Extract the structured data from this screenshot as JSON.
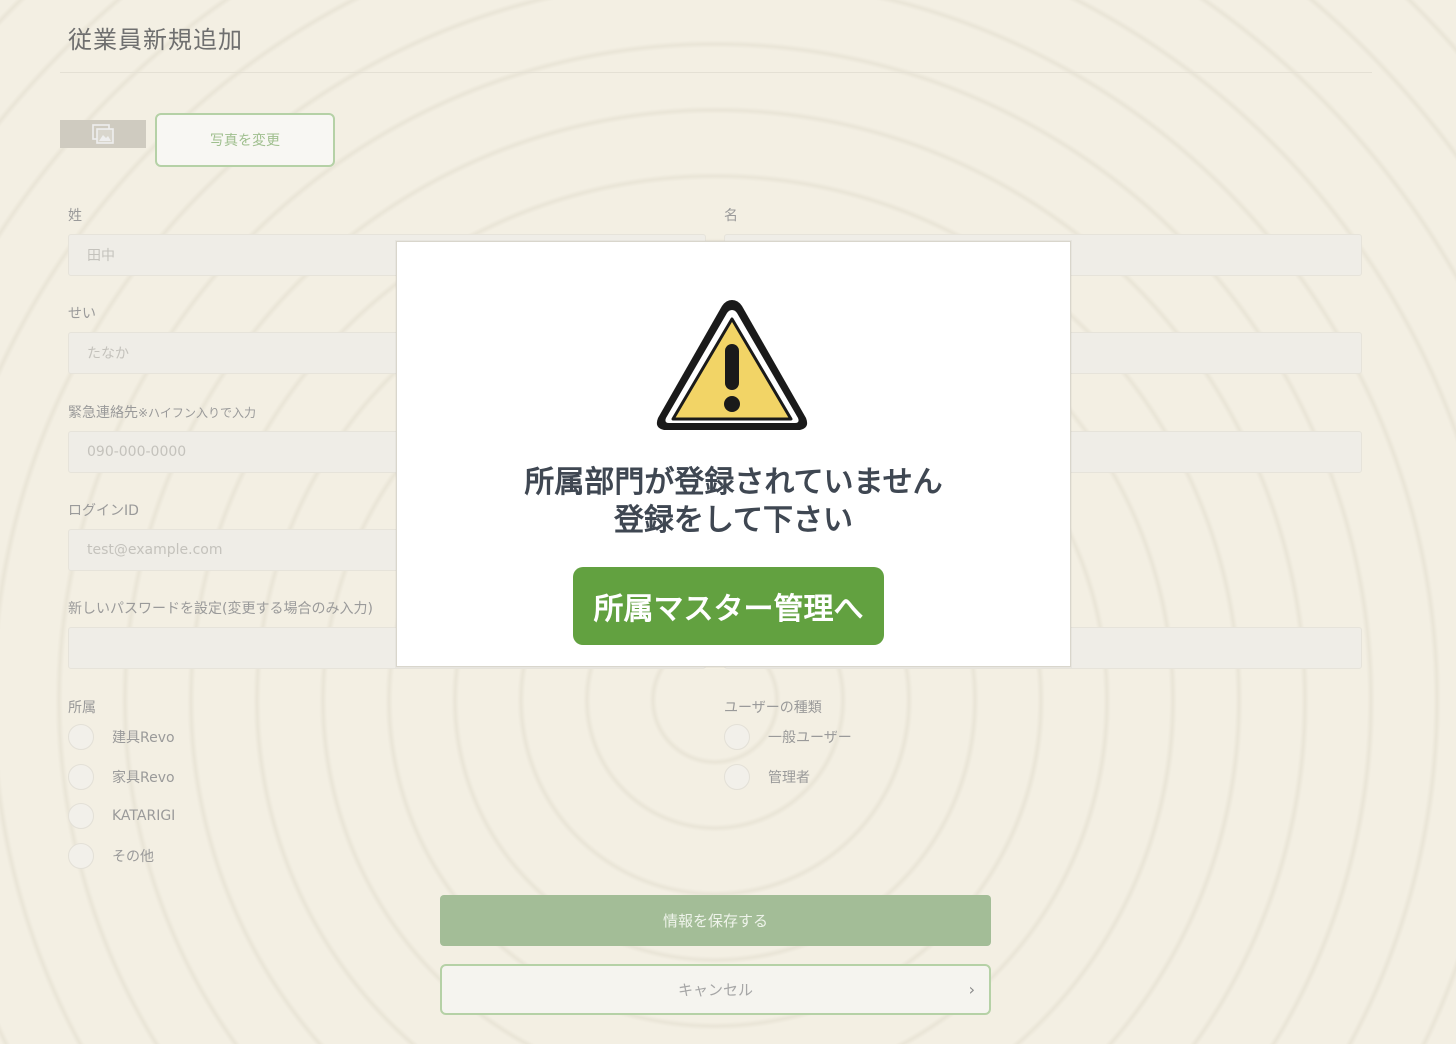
{
  "page": {
    "title": "従業員新規追加",
    "photo_button": "写真を変更"
  },
  "form": {
    "last_name": {
      "label": "姓",
      "placeholder": "田中"
    },
    "first_name": {
      "label": "名",
      "placeholder": ""
    },
    "last_name_kana": {
      "label": "せい",
      "placeholder": "たなか"
    },
    "emergency_contact": {
      "label": "緊急連絡先",
      "hint": "※ハイフン入りで入力",
      "placeholder": "090-000-0000"
    },
    "login_id": {
      "label": "ログインID",
      "placeholder": "test@example.com"
    },
    "new_password": {
      "label": "新しいパスワードを設定(変更する場合のみ入力)",
      "placeholder": ""
    },
    "affiliation": {
      "label": "所属",
      "options": [
        "建具Revo",
        "家具Revo",
        "KATARIGI",
        "その他"
      ]
    },
    "user_type": {
      "label": "ユーザーの種類",
      "options": [
        "一般ユーザー",
        "管理者"
      ]
    },
    "save_button": "情報を保存する",
    "cancel_button": "キャンセル"
  },
  "modal": {
    "message_line1": "所属部門が登録されていません",
    "message_line2": "登録をして下さい",
    "action_button": "所属マスター管理へ",
    "icon": "warning-triangle-icon",
    "colors": {
      "button": "#62a140",
      "warning_fill": "#f2d466"
    }
  }
}
